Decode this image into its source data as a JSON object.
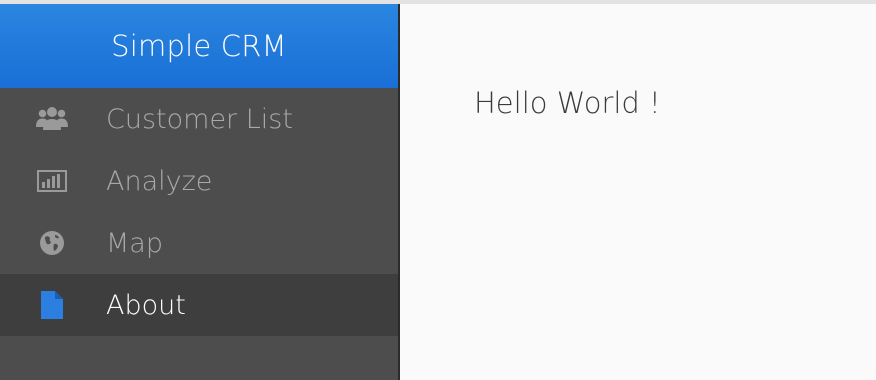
{
  "app": {
    "title": "Simple CRM"
  },
  "sidebar": {
    "items": [
      {
        "label": "Customer List",
        "icon": "users-icon",
        "active": false
      },
      {
        "label": "Analyze",
        "icon": "bar-chart-icon",
        "active": false
      },
      {
        "label": "Map",
        "icon": "globe-icon",
        "active": false
      },
      {
        "label": "About",
        "icon": "file-icon",
        "active": true
      }
    ]
  },
  "main": {
    "content": "Hello World !"
  },
  "colors": {
    "brand": "#1a6fd6",
    "sidebar_bg": "#4d4d4d",
    "active_bg": "#3e3e3e",
    "muted_text": "#a9a9a9",
    "content_bg": "#fafafa"
  }
}
